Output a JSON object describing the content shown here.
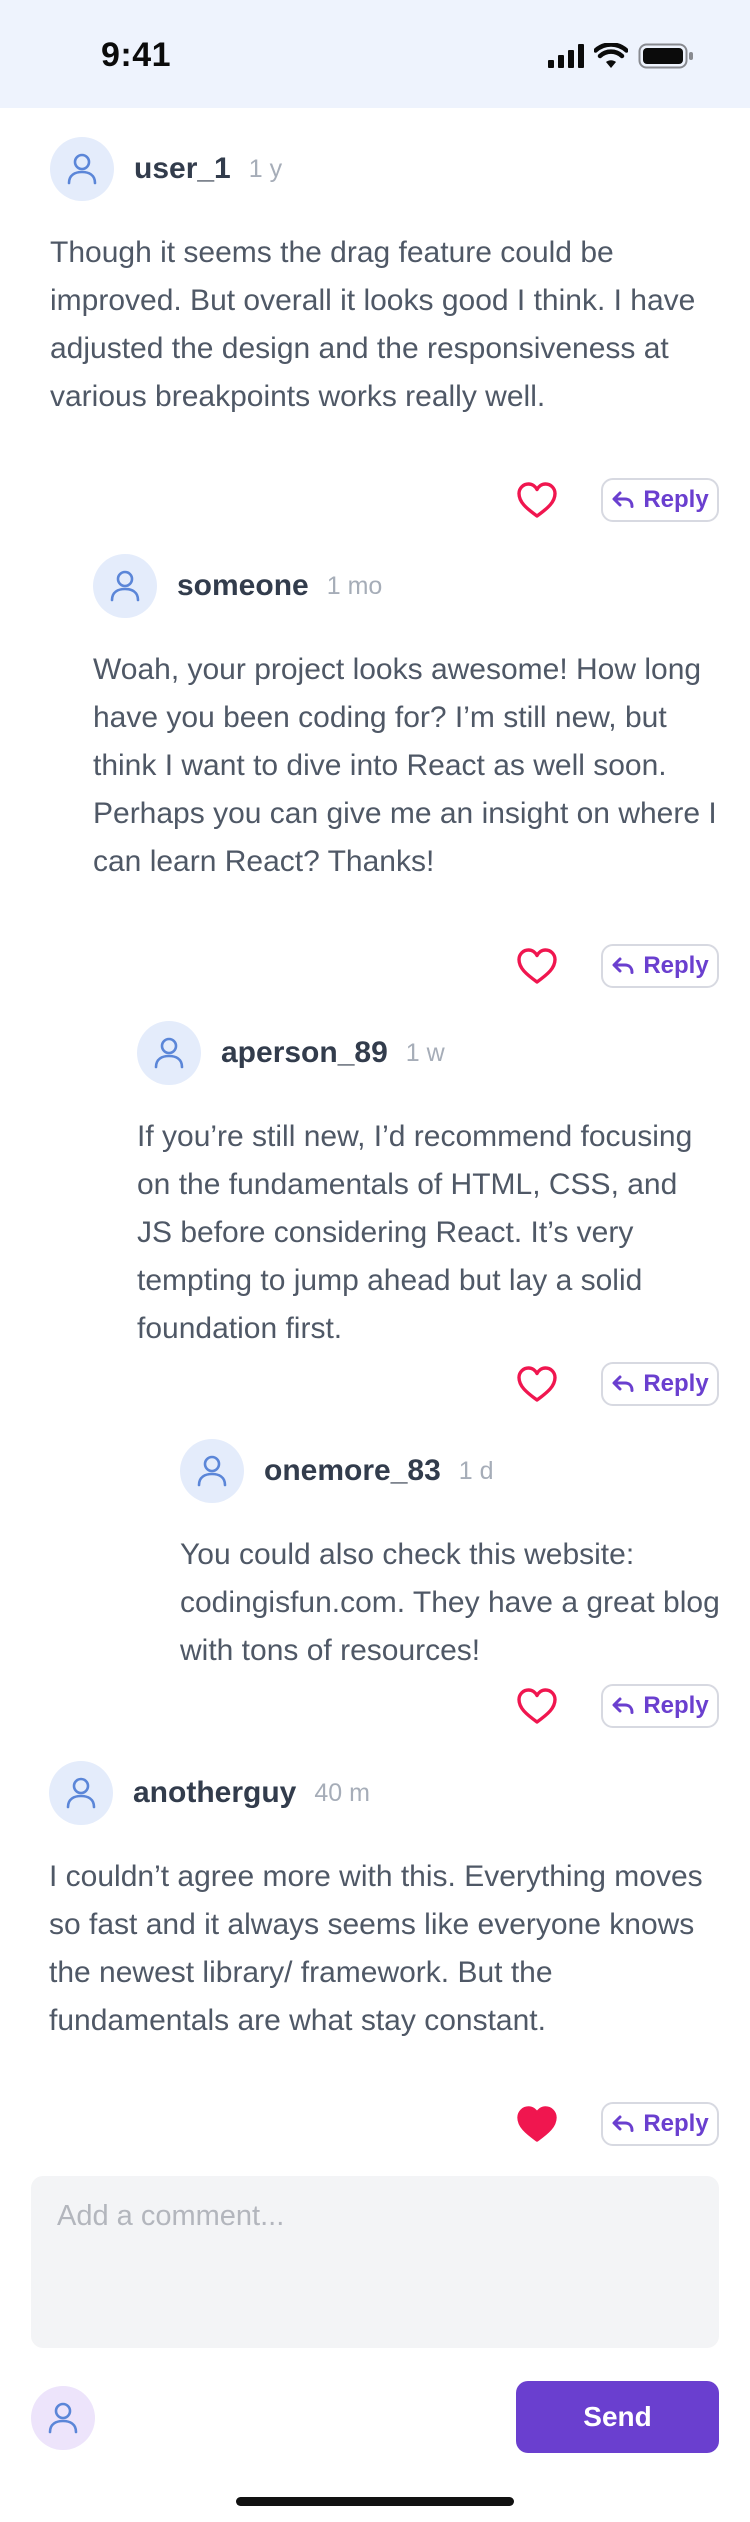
{
  "status_bar": {
    "time": "9:41"
  },
  "comments": [
    {
      "username": "user_1",
      "age": "1 y",
      "text": "Though it seems the drag feature could be improved. But overall it looks good I think. I have adjusted the design and the responsiveness at various breakpoints works really well.",
      "liked": false,
      "reply_label": "Reply"
    },
    {
      "username": "someone",
      "age": "1 mo",
      "text": "Woah, your project looks awesome! How long have you been coding for? I’m still new, but think I want to dive into React as well soon. Perhaps you can give me an insight on where I can learn React? Thanks!",
      "liked": false,
      "reply_label": "Reply"
    },
    {
      "username": "aperson_89",
      "age": "1 w",
      "text": "If you’re still new, I’d recommend focusing on the fundamentals of HTML, CSS, and JS before considering React. It’s very tempting to jump ahead but lay a solid foundation first.",
      "liked": false,
      "reply_label": "Reply"
    },
    {
      "username": "onemore_83",
      "age": "1 d",
      "text": "You could also check this website: codingisfun.com. They have a great blog with tons of resources!",
      "liked": false,
      "reply_label": "Reply"
    },
    {
      "username": "anotherguy",
      "age": "40 m",
      "text": "I couldn’t agree more with this. Everything moves so fast and it always seems like everyone knows the newest library/ framework. But the fundamentals are what stay constant.",
      "liked": true,
      "reply_label": "Reply"
    }
  ],
  "composer": {
    "placeholder": "Add a comment..."
  },
  "send_label": "Send",
  "colors": {
    "accent": "#6a3fcf",
    "heart": "#f0164f",
    "avatar_bg": "#e4ecfb",
    "status_bg": "#eef3fd"
  },
  "icons": [
    "user-icon",
    "heart-icon",
    "reply-arrow-icon",
    "signal-icon",
    "wifi-icon",
    "battery-icon"
  ]
}
